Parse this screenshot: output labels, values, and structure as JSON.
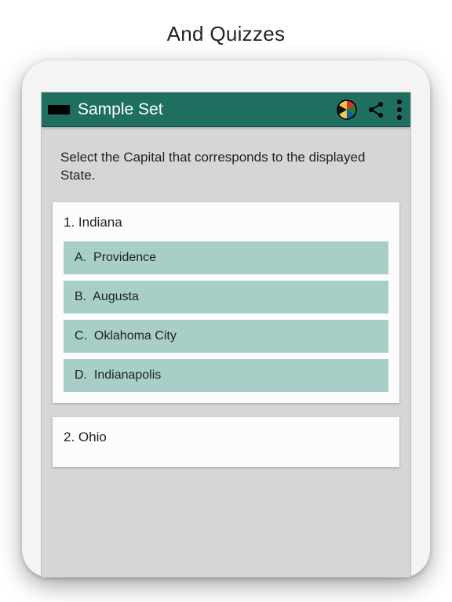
{
  "pageTitle": "And Quizzes",
  "topbar": {
    "title": "Sample Set"
  },
  "prompt": "Select the Capital that corresponds to the displayed State.",
  "questions": [
    {
      "number": "1.",
      "label": "Indiana",
      "options": [
        {
          "letter": "A.",
          "text": "Providence"
        },
        {
          "letter": "B.",
          "text": "Augusta"
        },
        {
          "letter": "C.",
          "text": "Oklahoma City"
        },
        {
          "letter": "D.",
          "text": "Indianapolis"
        }
      ]
    },
    {
      "number": "2.",
      "label": "Ohio",
      "options": []
    }
  ],
  "colors": {
    "topbar": "#1f6f61",
    "option": "#a7cfc7",
    "screenBg": "#d6d6d6"
  }
}
